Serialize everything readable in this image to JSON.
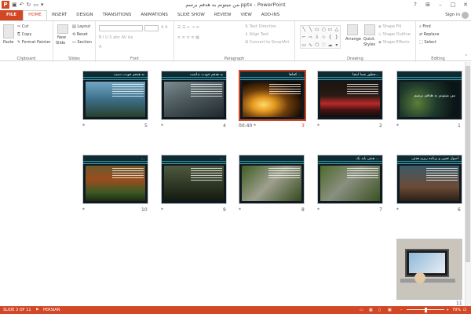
{
  "window": {
    "title": "من میتونم به هدفم برسم.pptx - PowerPoint",
    "app_icon": "P",
    "qat": [
      "save-icon",
      "undo-icon",
      "redo-icon",
      "start-from-beginning-icon",
      "customize-icon"
    ],
    "controls": [
      "?",
      "⊞",
      "–",
      "□",
      "✕"
    ]
  },
  "ribbon_tabs": [
    "FILE",
    "HOME",
    "INSERT",
    "DESIGN",
    "TRANSITIONS",
    "ANIMATIONS",
    "SLIDE SHOW",
    "REVIEW",
    "VIEW",
    "ADD-INS"
  ],
  "active_tab": "HOME",
  "sign_in": "Sign in",
  "ribbon": {
    "clipboard": {
      "label": "Clipboard",
      "paste": "Paste",
      "cut": "Cut",
      "copy": "Copy",
      "format_painter": "Format Painter"
    },
    "slides": {
      "label": "Slides",
      "new_slide": "New",
      "new_slide2": "Slide",
      "layout": "Layout",
      "reset": "Reset",
      "section": "Section"
    },
    "font": {
      "label": "Font"
    },
    "paragraph": {
      "label": "Paragraph",
      "text_direction": "Text Direction",
      "align_text": "Align Text",
      "convert": "Convert to SmartArt"
    },
    "drawing": {
      "label": "Drawing",
      "arrange": "Arrange",
      "quick_styles": "Quick",
      "quick_styles2": "Styles",
      "shape_fill": "Shape Fill",
      "shape_outline": "Shape Outline",
      "shape_effects": "Shape Effects"
    },
    "editing": {
      "label": "Editing",
      "find": "Find",
      "replace": "Replace",
      "select": "Select"
    }
  },
  "slides": [
    {
      "num": "1",
      "title": "من میتونم به هدفم برسم",
      "star": "*",
      "time": "",
      "theme": "cover"
    },
    {
      "num": "2",
      "title": "چطور شما اینجا...",
      "star": "*",
      "time": "",
      "theme": "crowd"
    },
    {
      "num": "3",
      "title": "کجاها ...",
      "star": "*",
      "time": "00:40",
      "theme": "sunset"
    },
    {
      "num": "4",
      "title": "به هدفم خودت نداشت",
      "star": "*",
      "time": "",
      "theme": "gray"
    },
    {
      "num": "5",
      "title": "به هدفم خودت دست",
      "star": "*",
      "time": "",
      "theme": "blue"
    },
    {
      "num": "6",
      "title": "اصول تعیین و برنامه ریزی هدف",
      "star": "*",
      "time": "",
      "theme": "ocean"
    },
    {
      "num": "7",
      "title": "هدف باید یک ...",
      "star": "*",
      "time": "",
      "theme": "road"
    },
    {
      "num": "8",
      "title": "",
      "star": "*",
      "time": "",
      "theme": "road"
    },
    {
      "num": "9",
      "title": "...",
      "star": "*",
      "time": "",
      "theme": "forest"
    },
    {
      "num": "10",
      "title": "...",
      "star": "*",
      "time": "",
      "theme": "autumn"
    },
    {
      "num": "11",
      "title": "",
      "star": "",
      "time": "",
      "theme": "laptop"
    }
  ],
  "status": {
    "slide_of": "SLIDE 3 OF 11",
    "language": "PERSIAN",
    "zoom": "79%",
    "zoom_fraction": 0.5
  },
  "colors": {
    "accent": "#d24726",
    "slide_band": "#0e2b34",
    "slide_line": "#2fa3b5"
  }
}
